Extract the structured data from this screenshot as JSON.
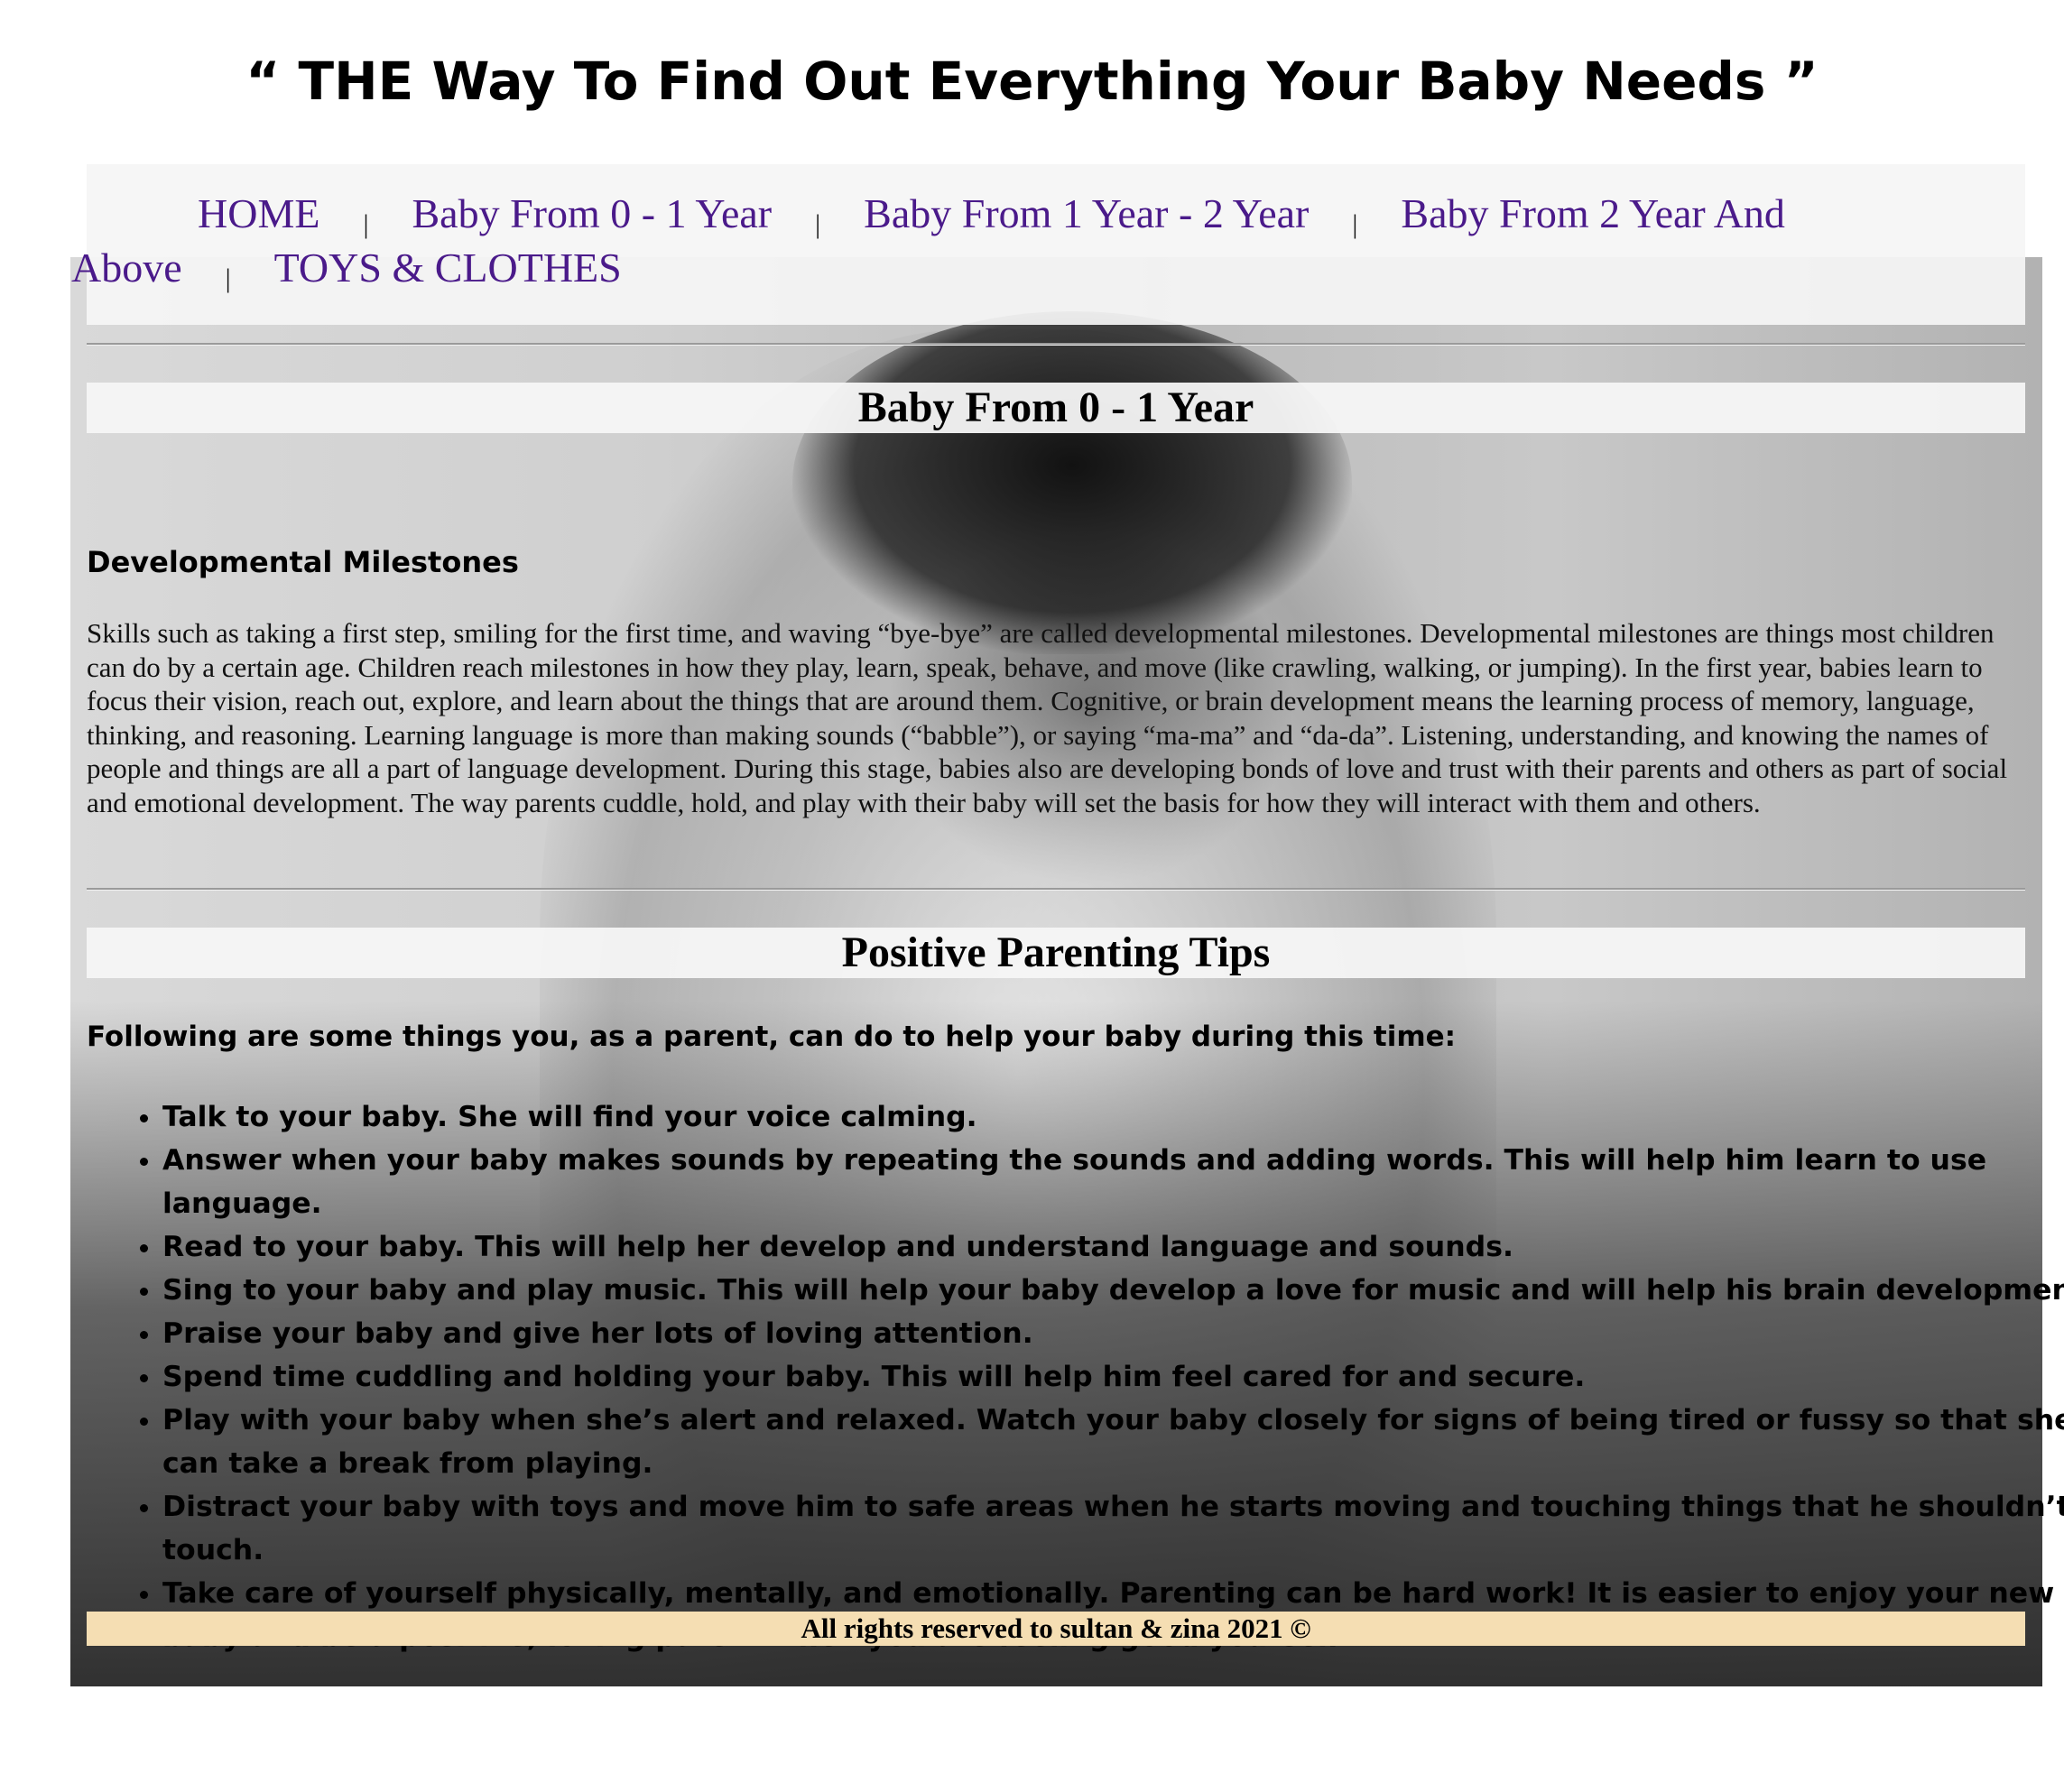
{
  "site_title": "“ THE Way To Find Out Everything Your Baby Needs ”",
  "nav": {
    "items": [
      {
        "label": "HOME"
      },
      {
        "label": "Baby From 0 - 1 Year"
      },
      {
        "label": "Baby From 1 Year - 2 Year"
      },
      {
        "label": "Baby From 2 Year And Above"
      },
      {
        "label": "TOYS & CLOTHES"
      }
    ],
    "separator": "|"
  },
  "section1": {
    "heading": "Baby From 0 - 1 Year",
    "subheading": "Developmental Milestones",
    "text": "Skills such as taking a first step, smiling for the first time, and waving “bye-bye” are called developmental milestones. Developmental milestones are things most children can do by a certain age. Children reach milestones in how they play, learn, speak, behave, and move (like crawling, walking, or jumping). In the first year, babies learn to focus their vision, reach out, explore, and learn about the things that are around them. Cognitive, or brain development means the learning process of memory, language, thinking, and reasoning. Learning language is more than making sounds (“babble”), or saying “ma-ma” and “da-da”. Listening, understanding, and knowing the names of people and things are all a part of language development. During this stage, babies also are developing bonds of love and trust with their parents and others as part of social and emotional development. The way parents cuddle, hold, and play with their baby will set the basis for how they will interact with them and others."
  },
  "section2": {
    "heading": "Positive Parenting Tips",
    "intro": "Following are some things you, as a parent, can do to help your baby during this time:",
    "tips": [
      "Talk to your baby. She will find your voice calming.",
      "Answer when your baby makes sounds by repeating the sounds and adding words. This will help him learn to use language.",
      "Read to your baby. This will help her develop and understand language and sounds.",
      "Sing to your baby and play music. This will help your baby develop a love for music and will help his brain development.",
      "Praise your baby and give her lots of loving attention.",
      "Spend time cuddling and holding your baby. This will help him feel cared for and secure.",
      "Play with your baby when she’s alert and relaxed. Watch your baby closely for signs of being tired or fussy so that she can take a break from playing.",
      "Distract your baby with toys and move him to safe areas when he starts moving and touching things that he shouldn’t touch.",
      "Take care of yourself physically, mentally, and emotionally. Parenting can be hard work! It is easier to enjoy your new baby and be a positive, loving parent when you are feeling good yourself."
    ]
  },
  "footer": {
    "text": "All rights reserved to sultan & zina 2021 ©"
  },
  "colors": {
    "nav_link": "#4a1a8a",
    "footer_bg": "#f5deb3",
    "heading_bg": "#f5f5f5"
  }
}
